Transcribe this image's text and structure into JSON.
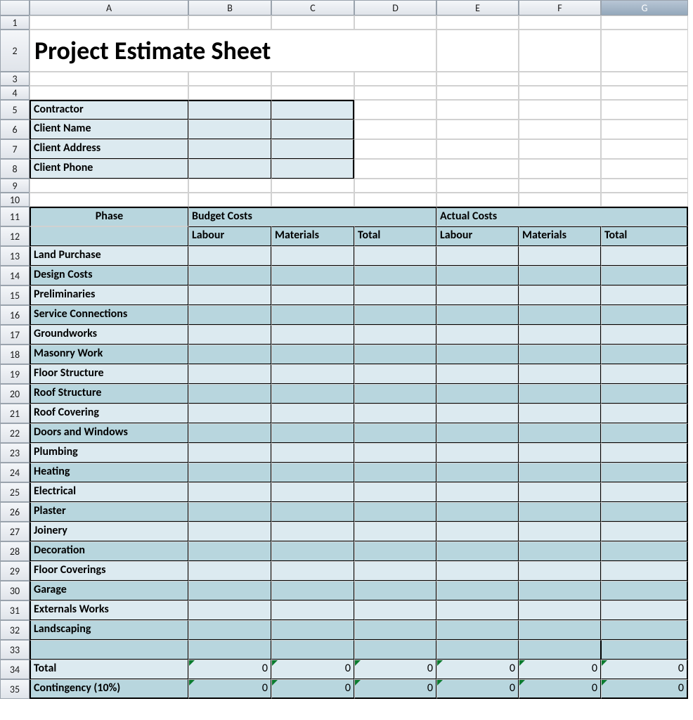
{
  "columns": [
    "A",
    "B",
    "C",
    "D",
    "E",
    "F",
    "G"
  ],
  "row_count": 35,
  "title": "Project Estimate Sheet",
  "client_info": {
    "rows": [
      {
        "label": "Contractor",
        "b": "",
        "c": ""
      },
      {
        "label": "Client Name",
        "b": "",
        "c": ""
      },
      {
        "label": "Client Address",
        "b": "",
        "c": ""
      },
      {
        "label": "Client Phone",
        "b": "",
        "c": ""
      }
    ]
  },
  "headers": {
    "phase": "Phase",
    "budget_costs": "Budget Costs",
    "actual_costs": "Actual Costs",
    "sub": {
      "labour": "Labour",
      "materials": "Materials",
      "total": "Total"
    }
  },
  "phases": [
    "Land Purchase",
    "Design Costs",
    "Preliminaries",
    "Service Connections",
    "Groundworks",
    "Masonry Work",
    "Floor Structure",
    "Roof Structure",
    "Roof Covering",
    "Doors and Windows",
    "Plumbing",
    "Heating",
    "Electrical",
    "Plaster",
    "Joinery",
    "Decoration",
    "Floor Coverings",
    "Garage",
    "Externals Works",
    "Landscaping"
  ],
  "footer": {
    "total_label": "Total",
    "contingency_label": "Contingency (10%)",
    "total_values": {
      "b": "0",
      "c": "0",
      "d": "0",
      "e": "0",
      "f": "0",
      "g": "0"
    },
    "contingency_values": {
      "b": "0",
      "c": "0",
      "d": "0",
      "e": "0",
      "f": "0",
      "g": "0"
    }
  }
}
